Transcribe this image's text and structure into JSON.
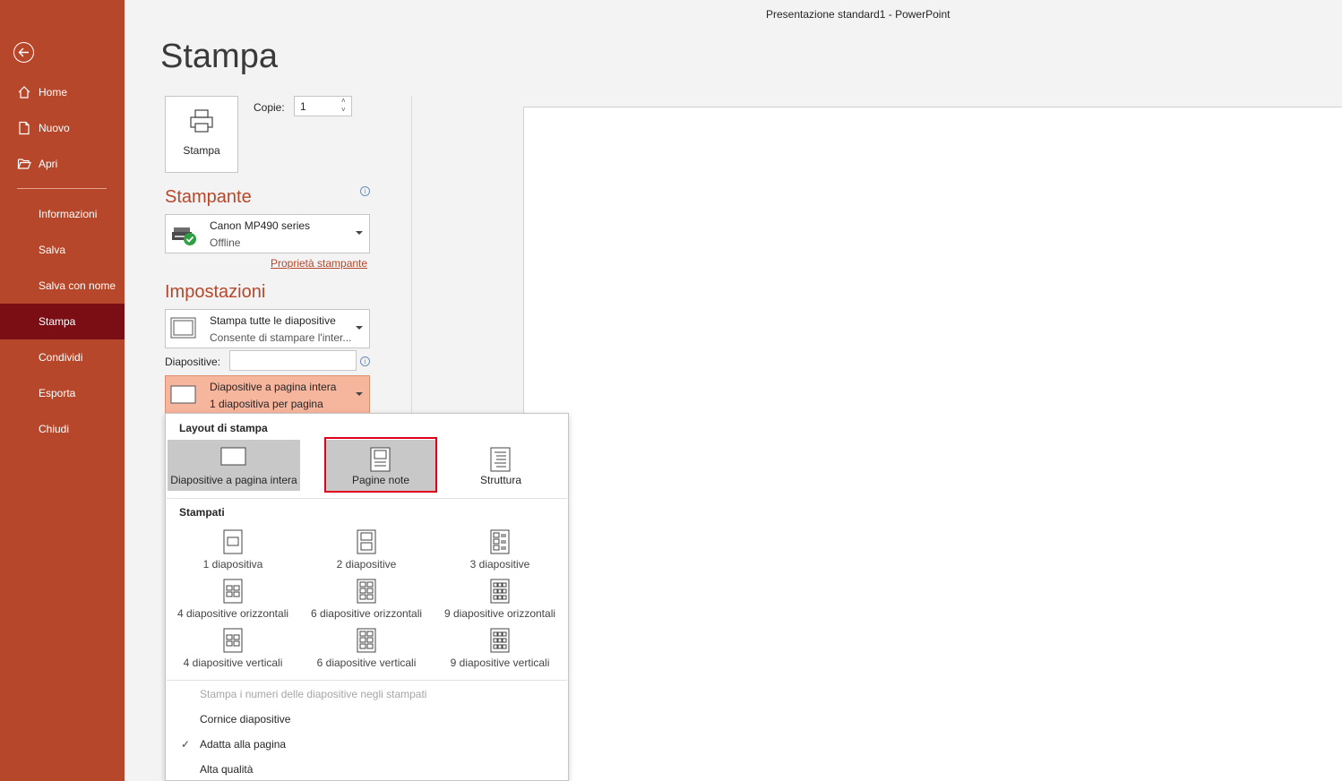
{
  "window": {
    "title": "Presentazione standard1  -  PowerPoint"
  },
  "sidebar": {
    "items": [
      {
        "label": "Home",
        "icon": "home-icon"
      },
      {
        "label": "Nuovo",
        "icon": "new-document-icon"
      },
      {
        "label": "Apri",
        "icon": "folder-open-icon"
      },
      {
        "label": "Informazioni"
      },
      {
        "label": "Salva"
      },
      {
        "label": "Salva con nome"
      },
      {
        "label": "Stampa",
        "active": true
      },
      {
        "label": "Condividi"
      },
      {
        "label": "Esporta"
      },
      {
        "label": "Chiudi"
      }
    ]
  },
  "page": {
    "title": "Stampa"
  },
  "print": {
    "button_label": "Stampa",
    "copies_label": "Copie:",
    "copies_value": "1"
  },
  "printer": {
    "section_title": "Stampante",
    "name": "Canon MP490 series",
    "status": "Offline",
    "properties_link": "Proprietà stampante"
  },
  "settings": {
    "section_title": "Impostazioni",
    "range": {
      "line1": "Stampa tutte le diapositive",
      "line2": "Consente di stampare l'inter..."
    },
    "slides_label": "Diapositive:",
    "slides_value": "",
    "layout": {
      "line1": "Diapositive a pagina intera",
      "line2": "1 diapositiva per pagina"
    }
  },
  "popup": {
    "layout_heading": "Layout di stampa",
    "layouts": [
      {
        "label": "Diapositive a pagina intera",
        "selected": true
      },
      {
        "label": "Pagine note",
        "selected": false,
        "highlighted": true
      },
      {
        "label": "Struttura",
        "selected": false
      }
    ],
    "handouts_heading": "Stampati",
    "handouts": [
      {
        "label": "1 diapositiva"
      },
      {
        "label": "2 diapositive"
      },
      {
        "label": "3 diapositive"
      },
      {
        "label": "4 diapositive orizzontali"
      },
      {
        "label": "6 diapositive orizzontali"
      },
      {
        "label": "9 diapositive orizzontali"
      },
      {
        "label": "4 diapositive verticali"
      },
      {
        "label": "6 diapositive verticali"
      },
      {
        "label": "9 diapositive verticali"
      }
    ],
    "options": [
      {
        "label": "Stampa i numeri delle diapositive negli stampati",
        "disabled": true,
        "checked": false
      },
      {
        "label": "Cornice diapositive",
        "disabled": false,
        "checked": false
      },
      {
        "label": "Adatta alla pagina",
        "disabled": false,
        "checked": true
      },
      {
        "label": "Alta qualità",
        "disabled": false,
        "checked": false
      }
    ]
  },
  "colors": {
    "accent": "#b7472a",
    "active_nav": "#7b0d15",
    "highlight": "#e0001a"
  }
}
